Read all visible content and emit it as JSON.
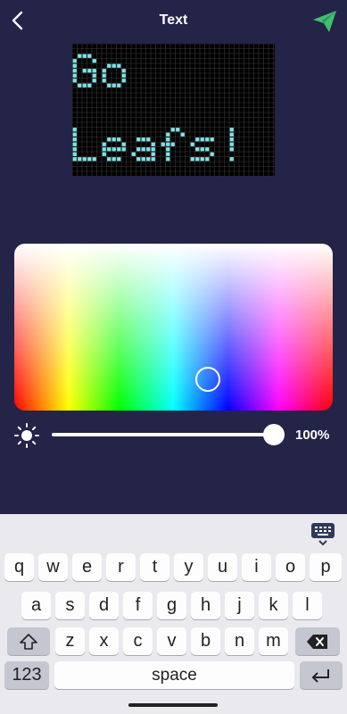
{
  "header": {
    "title": "Text"
  },
  "display": {
    "text_line1": "Go",
    "text_line2": "Leafs!",
    "pixel_color": "#7fe3e6",
    "background": "#000000"
  },
  "color_picker": {
    "selected_hue_fraction": 0.53,
    "selected_lightness_fraction": 0.8
  },
  "brightness": {
    "value_label": "100%",
    "value": 1.0
  },
  "keyboard": {
    "row1": [
      "q",
      "w",
      "e",
      "r",
      "t",
      "y",
      "u",
      "i",
      "o",
      "p"
    ],
    "row2": [
      "a",
      "s",
      "d",
      "f",
      "g",
      "h",
      "j",
      "k",
      "l"
    ],
    "row3": [
      "z",
      "x",
      "c",
      "v",
      "b",
      "n",
      "m"
    ],
    "numbers_label": "123",
    "space_label": "space"
  },
  "colors": {
    "background": "#242449",
    "send_icon": "#3fbf6f",
    "keyboard_bg": "#e9e9ee"
  }
}
